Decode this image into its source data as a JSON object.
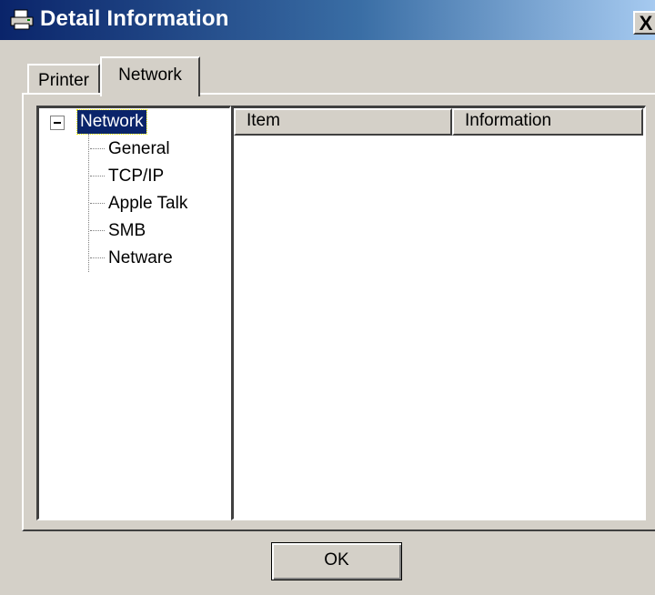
{
  "window": {
    "title": "Detail Information",
    "title_icon": "printer-icon",
    "close_label": "X"
  },
  "tabs": [
    {
      "label": "Printer",
      "selected": false
    },
    {
      "label": "Network",
      "selected": true
    }
  ],
  "tree": {
    "root": {
      "label": "Network",
      "expanded": true,
      "selected": true
    },
    "children": [
      "General",
      "TCP/IP",
      "Apple Talk",
      "SMB",
      "Netware"
    ]
  },
  "list": {
    "columns": [
      "Item",
      "Information"
    ],
    "rows": []
  },
  "buttons": {
    "ok_label": "OK"
  },
  "colors": {
    "title_start": "#0a246a",
    "title_end": "#a6caf0",
    "face": "#d4d0c8",
    "selection": "#0a246a"
  }
}
